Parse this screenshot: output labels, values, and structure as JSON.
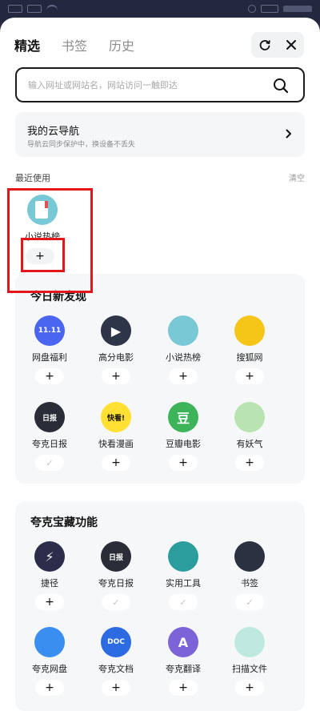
{
  "tabs": [
    "精选",
    "书签",
    "历史"
  ],
  "search": {
    "placeholder": "输入网址或网站名，网站访问一触即达"
  },
  "cloud": {
    "title": "我的云导航",
    "subtitle": "导航云同步保护中，换设备不丢失"
  },
  "recent": {
    "title": "最近使用",
    "clear": "清空",
    "items": [
      {
        "label": "小说热榜",
        "icon": "book-icon",
        "color": "#78c8d6",
        "action": "+"
      }
    ]
  },
  "discover": {
    "title": "今日新发现",
    "items": [
      {
        "label": "网盘福利",
        "icon": "netdisk-1111-icon",
        "glyph": "11.11",
        "color": "#4a66f0",
        "action": "+"
      },
      {
        "label": "高分电影",
        "icon": "play-icon",
        "glyph": "▶",
        "color": "#2f3548",
        "action": "+"
      },
      {
        "label": "小说热榜",
        "icon": "book-icon",
        "glyph": "",
        "color": "#78c8d6",
        "action": "+"
      },
      {
        "label": "搜狐网",
        "icon": "sohu-fox-icon",
        "glyph": "",
        "color": "#f5c518",
        "action": "+"
      },
      {
        "label": "夸克日报",
        "icon": "daily-news-icon",
        "glyph": "日报",
        "color": "#2a2d38",
        "action": "✓"
      },
      {
        "label": "快看漫画",
        "icon": "kuaikan-icon",
        "glyph": "快看!",
        "color": "#ffe033",
        "action": "+"
      },
      {
        "label": "豆瓣电影",
        "icon": "douban-icon",
        "glyph": "豆",
        "color": "#3db35a",
        "action": "+"
      },
      {
        "label": "有妖气",
        "icon": "youyaoqi-icon",
        "glyph": "",
        "color": "#b9e3b0",
        "action": "+"
      }
    ]
  },
  "quark": {
    "title": "夸克宝藏功能",
    "items": [
      {
        "label": "捷径",
        "icon": "shortcut-bolt-icon",
        "glyph": "⚡",
        "color": "#2c2d4a",
        "action": "+"
      },
      {
        "label": "夸克日报",
        "icon": "daily-news-icon",
        "glyph": "日报",
        "color": "#2a2d38",
        "action": "✓"
      },
      {
        "label": "实用工具",
        "icon": "toolbox-icon",
        "glyph": "",
        "color": "#2b9d9d",
        "action": "✓"
      },
      {
        "label": "书签",
        "icon": "bookmark-icon",
        "glyph": "",
        "color": "#2b3140",
        "action": "✓"
      },
      {
        "label": "夸克网盘",
        "icon": "cloud-drive-icon",
        "glyph": "",
        "color": "#3a8ef0",
        "action": "+"
      },
      {
        "label": "夸克文档",
        "icon": "doc-icon",
        "glyph": "DOC",
        "color": "#2d6be3",
        "action": "+"
      },
      {
        "label": "夸克翻译",
        "icon": "translate-icon",
        "glyph": "A",
        "color": "#7d63d8",
        "action": "+"
      },
      {
        "label": "扫描文件",
        "icon": "scan-icon",
        "glyph": "",
        "color": "#bfe9df",
        "action": "+"
      }
    ]
  }
}
